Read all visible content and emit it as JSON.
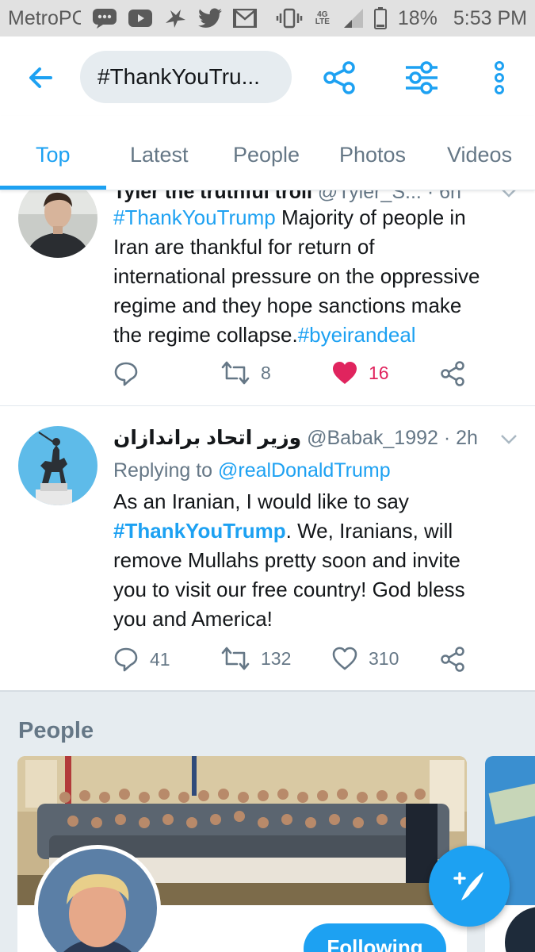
{
  "status_bar": {
    "carrier": "MetroPCS",
    "network": "4G LTE",
    "battery": "18%",
    "time": "5:53 PM",
    "icons": [
      "message-icon",
      "youtube-icon",
      "bird-icon",
      "twitter-icon",
      "gmail-icon",
      "vibrate-icon",
      "signal-icon",
      "battery-icon"
    ]
  },
  "header": {
    "back_icon": "arrow-left-icon",
    "search_query": "#ThankYouTru...",
    "share_icon": "share-icon",
    "filter_icon": "sliders-icon",
    "more_icon": "more-vertical-icon"
  },
  "tabs": [
    {
      "label": "Top",
      "active": true
    },
    {
      "label": "Latest",
      "active": false
    },
    {
      "label": "People",
      "active": false
    },
    {
      "label": "Photos",
      "active": false
    },
    {
      "label": "Videos",
      "active": false
    }
  ],
  "tweets": [
    {
      "name": "Tyler the truthful troll",
      "handle": "@Tyler_S...",
      "time": "6h",
      "text": {
        "hashtag1": "#ThankYouTrump",
        "line1": " Majority of people in",
        "line2": "Iran are thankful for return of",
        "line3": "international pressure on the oppressive",
        "line4": "regime and they hope sanctions make",
        "line5": "the regime collapse.",
        "hashtag2": "#byeirandeal"
      },
      "replies": "",
      "retweets": "8",
      "likes": "16",
      "liked": true
    },
    {
      "name": "وزیر اتحاد براندازان",
      "handle": "@Babak_1992",
      "time": "2h",
      "reply_prefix": "Replying to ",
      "reply_to": "@realDonaldTrump",
      "text": {
        "line1": "As an Iranian, I would like to say",
        "hashtag": "#ThankYouTrump",
        "line2_rest": ". We, Iranians, will",
        "line3": "remove Mullahs pretty soon and invite",
        "line4": "you to visit our free country! God bless",
        "line5": "you and America!"
      },
      "replies": "41",
      "retweets": "132",
      "likes": "310",
      "liked": false
    }
  ],
  "people": {
    "title": "People",
    "card": {
      "follow_label": "Following"
    }
  },
  "fab": {
    "icon": "compose-tweet-icon"
  },
  "colors": {
    "accent": "#1da1f2",
    "like": "#e0245e",
    "secondary_text": "#657786",
    "status_bar_bg": "#e1e1e1",
    "section_bg": "#e6ecf0"
  }
}
